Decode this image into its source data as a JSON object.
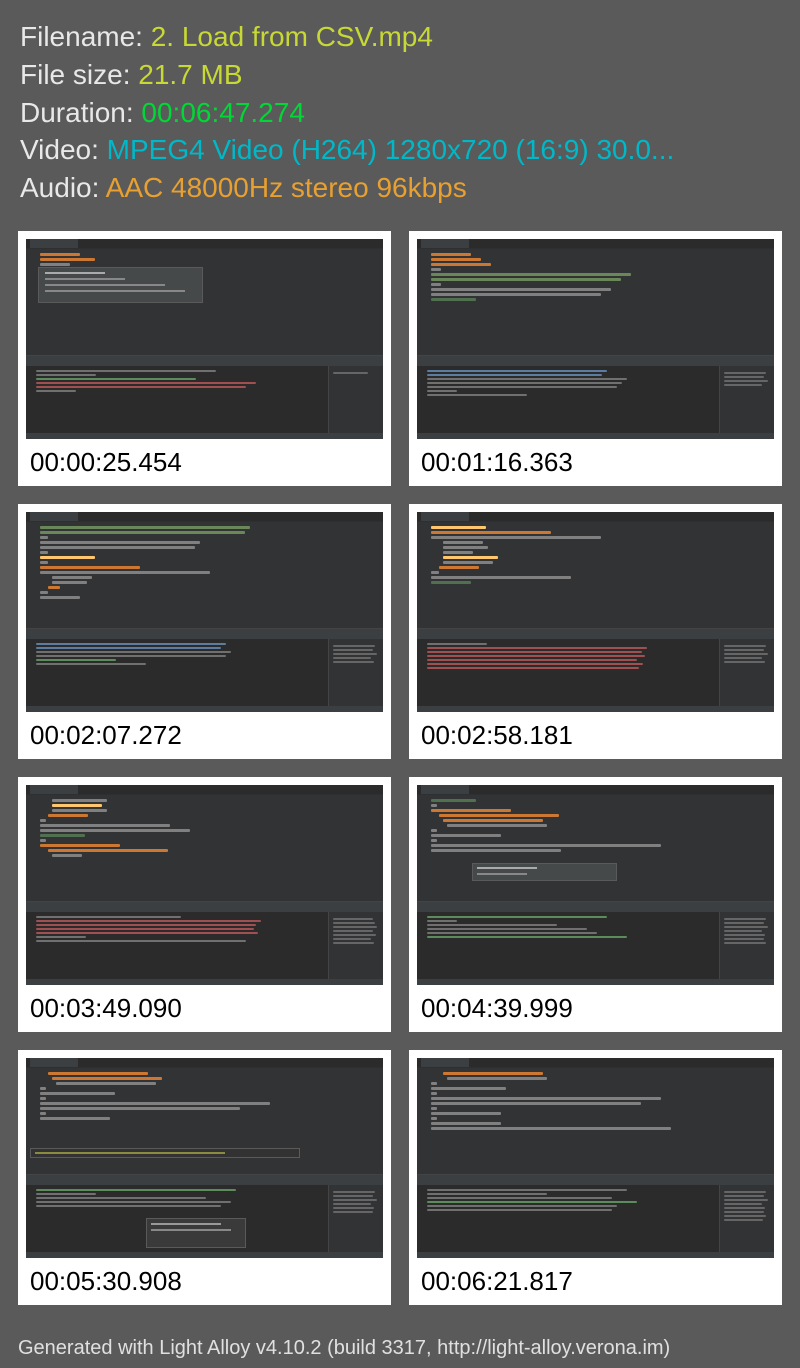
{
  "info": {
    "filename_label": "Filename: ",
    "filename_value": "2. Load from CSV.mp4",
    "filesize_label": "File size: ",
    "filesize_value": "21.7 MB",
    "duration_label": "Duration: ",
    "duration_value": "00:06:47.274",
    "video_label": "Video: ",
    "video_value": "MPEG4 Video (H264) 1280x720 (16:9) 30.0...",
    "audio_label": "Audio: ",
    "audio_value": "AAC 48000Hz stereo 96kbps"
  },
  "thumbnails": [
    {
      "time": "00:00:25.454"
    },
    {
      "time": "00:01:16.363"
    },
    {
      "time": "00:02:07.272"
    },
    {
      "time": "00:02:58.181"
    },
    {
      "time": "00:03:49.090"
    },
    {
      "time": "00:04:39.999"
    },
    {
      "time": "00:05:30.908"
    },
    {
      "time": "00:06:21.817"
    }
  ],
  "footer": "Generated with Light Alloy v4.10.2 (build 3317, http://light-alloy.verona.im)"
}
